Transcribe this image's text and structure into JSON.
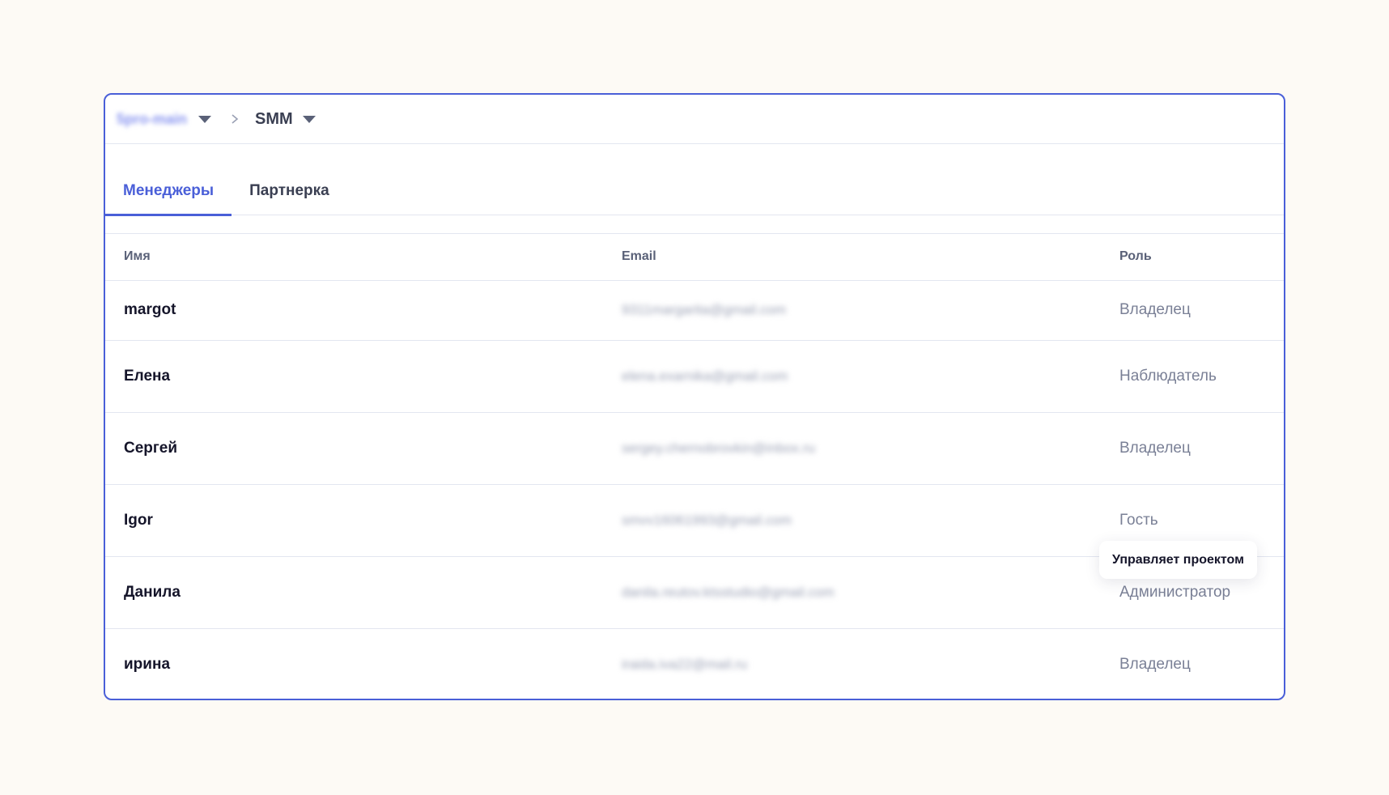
{
  "breadcrumb": {
    "workspace": "5pro-main",
    "project": "SMM"
  },
  "tabs": [
    {
      "label": "Менеджеры",
      "active": true
    },
    {
      "label": "Партнерка",
      "active": false
    }
  ],
  "table": {
    "columns": [
      "Имя",
      "Email",
      "Роль"
    ],
    "rows": [
      {
        "name": "margot",
        "email": "9311margarita@gmail.com",
        "role": "Владелец"
      },
      {
        "name": "Елена",
        "email": "elena.exarnika@gmail.com",
        "role": "Наблюдатель"
      },
      {
        "name": "Сергей",
        "email": "sergey.chernobrovkin@inbox.ru",
        "role": "Владелец"
      },
      {
        "name": "Igor",
        "email": "smvv16061993@gmail.com",
        "role": "Гость"
      },
      {
        "name": "Данила",
        "email": "danila.reutov.ktsstudio@gmail.com",
        "role": "Администратор"
      },
      {
        "name": "ирина",
        "email": "iraida.iva22@mail.ru",
        "role": "Владелец"
      }
    ]
  },
  "tooltip": {
    "text": "Управляет проектом"
  },
  "colors": {
    "accent": "#4a5fd8",
    "background": "#fdfaf5"
  }
}
